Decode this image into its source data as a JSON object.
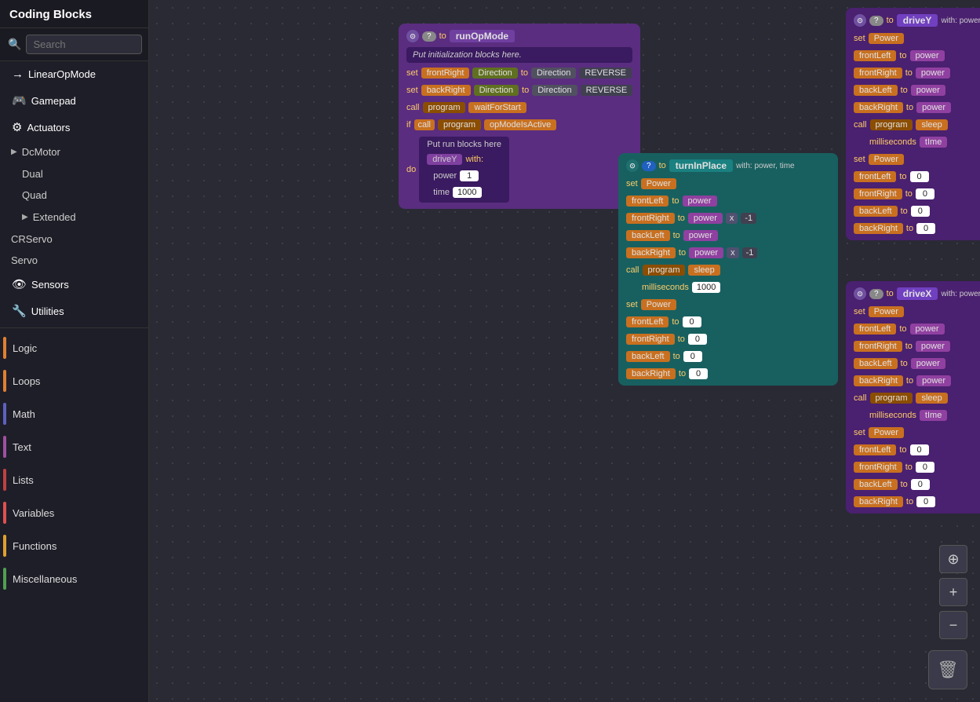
{
  "sidebar": {
    "title": "Coding Blocks",
    "search_placeholder": "Search",
    "items": [
      {
        "id": "linear-op-mode",
        "label": "LinearOpMode",
        "icon": "→",
        "color": null
      },
      {
        "id": "gamepad",
        "label": "Gamepad",
        "icon": "🎮",
        "color": null
      },
      {
        "id": "actuators",
        "label": "Actuators",
        "icon": "⚙",
        "color": null
      },
      {
        "id": "dcmotor",
        "label": "DcMotor",
        "icon": "▶",
        "color": null,
        "indent": false,
        "caret": true
      },
      {
        "id": "dual",
        "label": "Dual",
        "indent": true
      },
      {
        "id": "quad",
        "label": "Quad",
        "indent": true
      },
      {
        "id": "extended",
        "label": "Extended",
        "indent": true,
        "caret": true
      },
      {
        "id": "crservo",
        "label": "CRServo",
        "indent": false
      },
      {
        "id": "servo",
        "label": "Servo",
        "indent": false
      },
      {
        "id": "sensors",
        "label": "Sensors",
        "icon": "👁",
        "color": null
      },
      {
        "id": "utilities",
        "label": "Utilities",
        "icon": "🔧",
        "color": null
      }
    ],
    "colored_items": [
      {
        "id": "logic",
        "label": "Logic",
        "color": "#e08030"
      },
      {
        "id": "loops",
        "label": "Loops",
        "color": "#e08030"
      },
      {
        "id": "math",
        "label": "Math",
        "color": "#6060c0"
      },
      {
        "id": "text",
        "label": "Text",
        "color": "#a050a0"
      },
      {
        "id": "lists",
        "label": "Lists",
        "color": "#c04040"
      },
      {
        "id": "variables",
        "label": "Variables",
        "color": "#e05050"
      },
      {
        "id": "functions",
        "label": "Functions",
        "color": "#e0a030"
      },
      {
        "id": "miscellaneous",
        "label": "Miscellaneous",
        "color": "#50a050"
      }
    ]
  },
  "blocks": {
    "run_op_mode": {
      "title": "runOpMode",
      "init_placeholder": "Put initialization blocks here.",
      "run_placeholder": "Put run blocks here",
      "front_right_set": "frontRight",
      "back_right_set": "backRight",
      "direction_label": "Direction",
      "direction_reverse": "REVERSE",
      "call_program": "program",
      "wait_for_start": "waitForStart",
      "if_label": "if",
      "call_label2": "program",
      "op_mode_active": "opModeIsActive",
      "do_label": "do",
      "drive_y": "driveY",
      "with_label": "with:",
      "power_label": "power",
      "time_label": "time",
      "power_value": "1",
      "time_value": "1000"
    },
    "turn_in_place": {
      "title": "turnInPlace",
      "with_label": "with: power, time",
      "set_power": "Power",
      "front_left": "frontLeft",
      "front_right": "frontRight",
      "back_left": "backLeft",
      "back_right": "backRight",
      "to_label": "to",
      "power_var": "power",
      "call_program": "program",
      "sleep_label": "sleep",
      "milliseconds": "milliseconds",
      "sleep_val": "1000",
      "multiply": "x",
      "neg1": "-1"
    },
    "drive_y_func": {
      "title": "driveY",
      "with_label": "with: power, time",
      "set_power": "Power",
      "front_left": "frontLeft",
      "front_right": "frontRight",
      "back_left": "backLeft",
      "back_right": "backRight",
      "to_label": "to",
      "power_var": "power",
      "call_program": "program",
      "sleep_label": "sleep",
      "milliseconds": "milliseconds",
      "time_var": "tIme",
      "zero": "0"
    },
    "drive_x_func": {
      "title": "driveX",
      "with_label": "with: power, time",
      "set_power": "Power",
      "front_left": "frontLeft",
      "front_right": "frontRight",
      "back_left": "backLeft",
      "back_right": "backRight",
      "to_label": "to",
      "power_var": "power",
      "call_program": "program",
      "sleep_label": "sleep",
      "milliseconds": "milliseconds",
      "time_var": "tIme",
      "zero": "0"
    }
  },
  "controls": {
    "recenter_icon": "⊕",
    "zoom_in_icon": "+",
    "zoom_out_icon": "−",
    "trash_icon": "🗑"
  }
}
